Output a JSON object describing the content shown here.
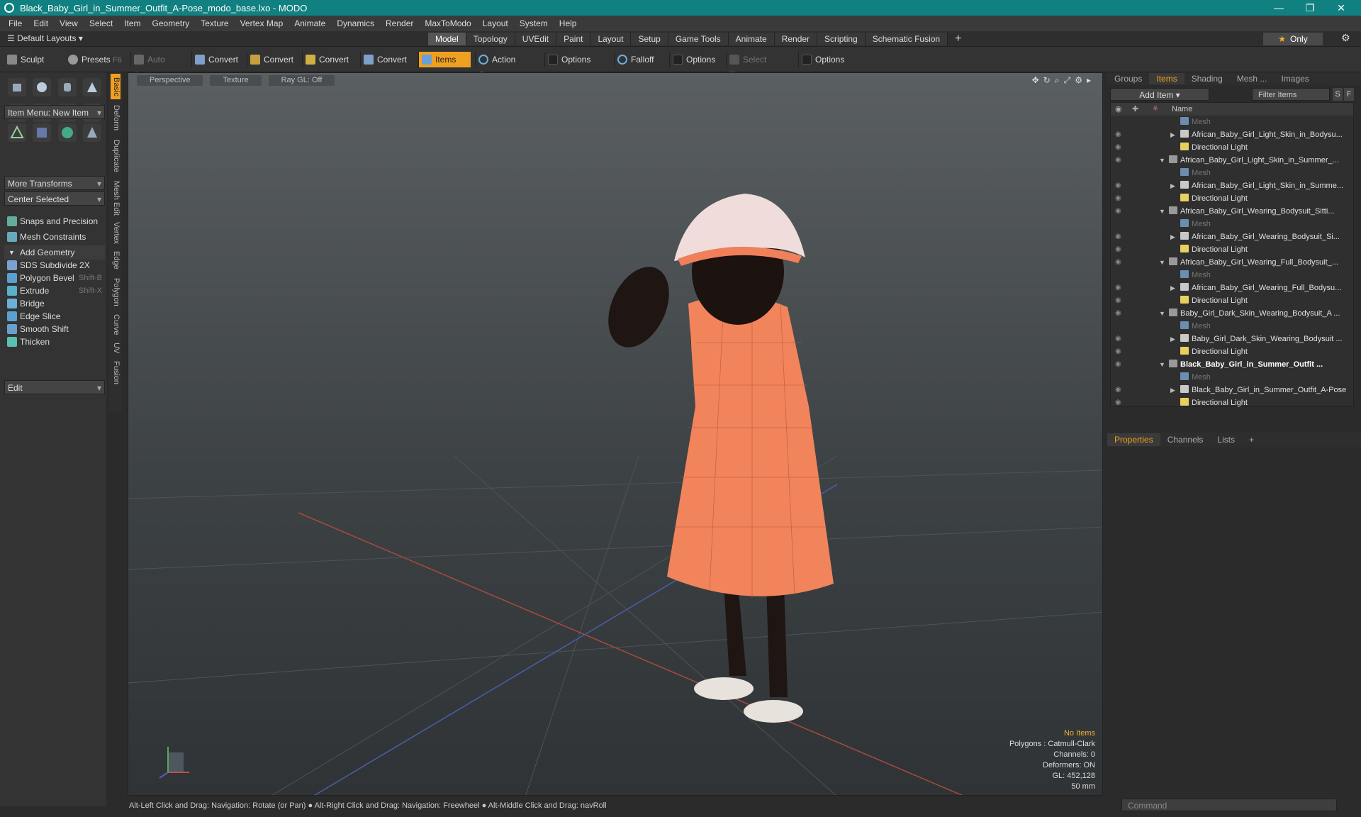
{
  "window": {
    "title": "Black_Baby_Girl_in_Summer_Outfit_A-Pose_modo_base.lxo - MODO"
  },
  "menu": [
    "File",
    "Edit",
    "View",
    "Select",
    "Item",
    "Geometry",
    "Texture",
    "Vertex Map",
    "Animate",
    "Dynamics",
    "Render",
    "MaxToModo",
    "Layout",
    "System",
    "Help"
  ],
  "layouts": {
    "label": "Default Layouts"
  },
  "tabs": [
    "Model",
    "Topology",
    "UVEdit",
    "Paint",
    "Layout",
    "Setup",
    "Game Tools",
    "Animate",
    "Render",
    "Scripting",
    "Schematic Fusion"
  ],
  "only_label": "Only",
  "toolbar": {
    "sculpt": "Sculpt",
    "presets": "Presets",
    "presets_key": "F6",
    "auto_select": "Auto Select",
    "convert1": "Convert",
    "convert2": "Convert",
    "convert3": "Convert",
    "convert4": "Convert",
    "items": "Items",
    "action_center": "Action Center",
    "options1": "Options",
    "falloff": "Falloff",
    "options2": "Options",
    "select_through": "Select Through",
    "options3": "Options"
  },
  "left": {
    "item_menu": "Item Menu: New Item",
    "more_transforms": "More Transforms",
    "center_selected": "Center Selected",
    "snaps": "Snaps and Precision",
    "mesh_constraints": "Mesh Constraints",
    "add_geometry": "Add Geometry",
    "tools": [
      {
        "label": "SDS Subdivide 2X",
        "shortcut": ""
      },
      {
        "label": "Polygon Bevel",
        "shortcut": "Shift-B"
      },
      {
        "label": "Extrude",
        "shortcut": "Shift-X"
      },
      {
        "label": "Bridge",
        "shortcut": ""
      },
      {
        "label": "Edge Slice",
        "shortcut": ""
      },
      {
        "label": "Smooth Shift",
        "shortcut": ""
      },
      {
        "label": "Thicken",
        "shortcut": ""
      }
    ],
    "edit": "Edit"
  },
  "vtabs": [
    "Basic",
    "Deform",
    "Duplicate",
    "Mesh Edit",
    "Vertex",
    "Edge",
    "Polygon",
    "Curve",
    "UV",
    "Fusion"
  ],
  "viewport": {
    "tabs": [
      "Perspective",
      "Texture",
      "Ray GL: Off"
    ],
    "info": {
      "no_items": "No Items",
      "polygons": "Polygons : Catmull-Clark",
      "channels": "Channels: 0",
      "deformers": "Deformers: ON",
      "gl": "GL: 452,128",
      "lens": "50 mm"
    }
  },
  "status": "Alt-Left Click and Drag: Navigation: Rotate (or Pan) ● Alt-Right Click and Drag: Navigation: Freewheel ● Alt-Middle Click and Drag: navRoll",
  "right": {
    "tabs": [
      "Groups",
      "Items",
      "Shading",
      "Mesh ...",
      "Images"
    ],
    "add_item": "Add Item",
    "filter": "Filter Items",
    "s": "S",
    "f": "F",
    "name_header": "Name",
    "rows": [
      {
        "label": "Mesh",
        "type": "mesh",
        "indent": 2,
        "dim": true
      },
      {
        "label": "African_Baby_Girl_Light_Skin_in_Bodysu...",
        "type": "item",
        "indent": 2,
        "tri": "▶"
      },
      {
        "label": "Directional Light",
        "type": "light",
        "indent": 2
      },
      {
        "label": "African_Baby_Girl_Light_Skin_in_Summer_...",
        "type": "group",
        "indent": 1,
        "tri": "▼"
      },
      {
        "label": "Mesh",
        "type": "mesh",
        "indent": 2,
        "dim": true
      },
      {
        "label": "African_Baby_Girl_Light_Skin_in_Summe...",
        "type": "item",
        "indent": 2,
        "tri": "▶"
      },
      {
        "label": "Directional Light",
        "type": "light",
        "indent": 2
      },
      {
        "label": "African_Baby_Girl_Wearing_Bodysuit_Sitti...",
        "type": "group",
        "indent": 1,
        "tri": "▼"
      },
      {
        "label": "Mesh",
        "type": "mesh",
        "indent": 2,
        "dim": true
      },
      {
        "label": "African_Baby_Girl_Wearing_Bodysuit_Si...",
        "type": "item",
        "indent": 2,
        "tri": "▶"
      },
      {
        "label": "Directional Light",
        "type": "light",
        "indent": 2
      },
      {
        "label": "African_Baby_Girl_Wearing_Full_Bodysuit_...",
        "type": "group",
        "indent": 1,
        "tri": "▼"
      },
      {
        "label": "Mesh",
        "type": "mesh",
        "indent": 2,
        "dim": true
      },
      {
        "label": "African_Baby_Girl_Wearing_Full_Bodysu...",
        "type": "item",
        "indent": 2,
        "tri": "▶"
      },
      {
        "label": "Directional Light",
        "type": "light",
        "indent": 2
      },
      {
        "label": "Baby_Girl_Dark_Skin_Wearing_Bodysuit_A ...",
        "type": "group",
        "indent": 1,
        "tri": "▼"
      },
      {
        "label": "Mesh",
        "type": "mesh",
        "indent": 2,
        "dim": true
      },
      {
        "label": "Baby_Girl_Dark_Skin_Wearing_Bodysuit ...",
        "type": "item",
        "indent": 2,
        "tri": "▶"
      },
      {
        "label": "Directional Light",
        "type": "light",
        "indent": 2
      },
      {
        "label": "Black_Baby_Girl_in_Summer_Outfit ...",
        "type": "group",
        "indent": 1,
        "tri": "▼",
        "bold": true
      },
      {
        "label": "Mesh",
        "type": "mesh",
        "indent": 2,
        "dim": true
      },
      {
        "label": "Black_Baby_Girl_in_Summer_Outfit_A-Pose",
        "type": "item",
        "indent": 2,
        "tri": "▶"
      },
      {
        "label": "Directional Light",
        "type": "light",
        "indent": 2
      }
    ],
    "props_tabs": [
      "Properties",
      "Channels",
      "Lists"
    ],
    "command_placeholder": "Command"
  }
}
